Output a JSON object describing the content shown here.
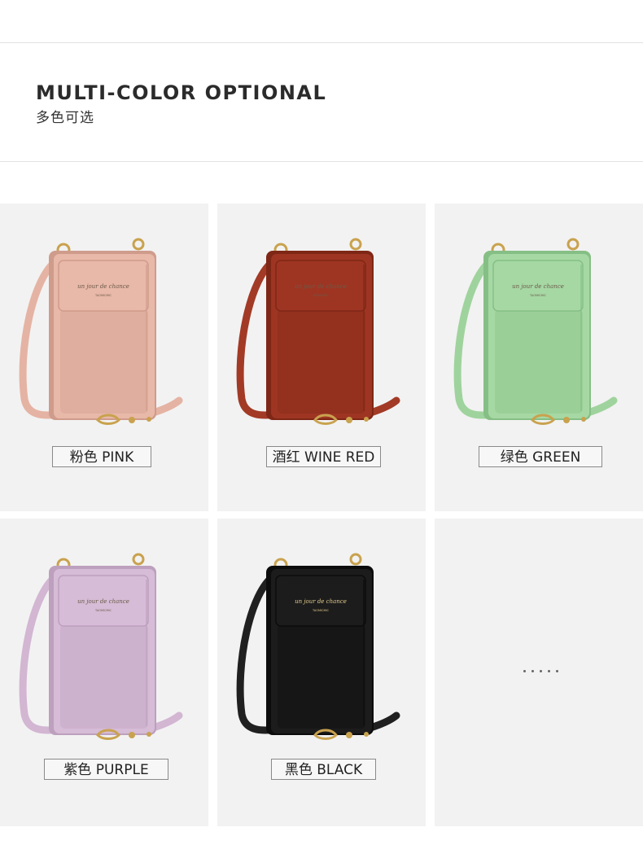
{
  "header": {
    "title": "MULTI-COLOR OPTIONAL",
    "subtitle": "多色可选"
  },
  "products": [
    {
      "label": "粉色 PINK",
      "color": "#e8b8a8",
      "dark": "#cf9c8c",
      "strap": "#e5b3a3",
      "script": "un jour de chance",
      "brand": "TAOMICMIC"
    },
    {
      "label": "酒红 WINE RED",
      "color": "#9e3522",
      "dark": "#7f2716",
      "strap": "#a23a26",
      "script": "un jour de chance",
      "brand": "TAOMICMIC"
    },
    {
      "label": "绿色 GREEN",
      "color": "#a6d8a4",
      "dark": "#86bf85",
      "strap": "#9fd39d",
      "script": "un jour de chance",
      "brand": "TAOMICMIC"
    },
    {
      "label": "紫色 PURPLE",
      "color": "#d6bcd6",
      "dark": "#bda0bd",
      "strap": "#d2b6d2",
      "script": "un jour de chance",
      "brand": "TAOMICMIC"
    },
    {
      "label": "黑色 BLACK",
      "color": "#1c1c1c",
      "dark": "#0c0c0c",
      "strap": "#202020",
      "script": "un jour de chance",
      "brand": "TAOMICMIC"
    }
  ],
  "colors": {
    "gold": "#c9a24e",
    "placeholder_dots": "#666666"
  }
}
